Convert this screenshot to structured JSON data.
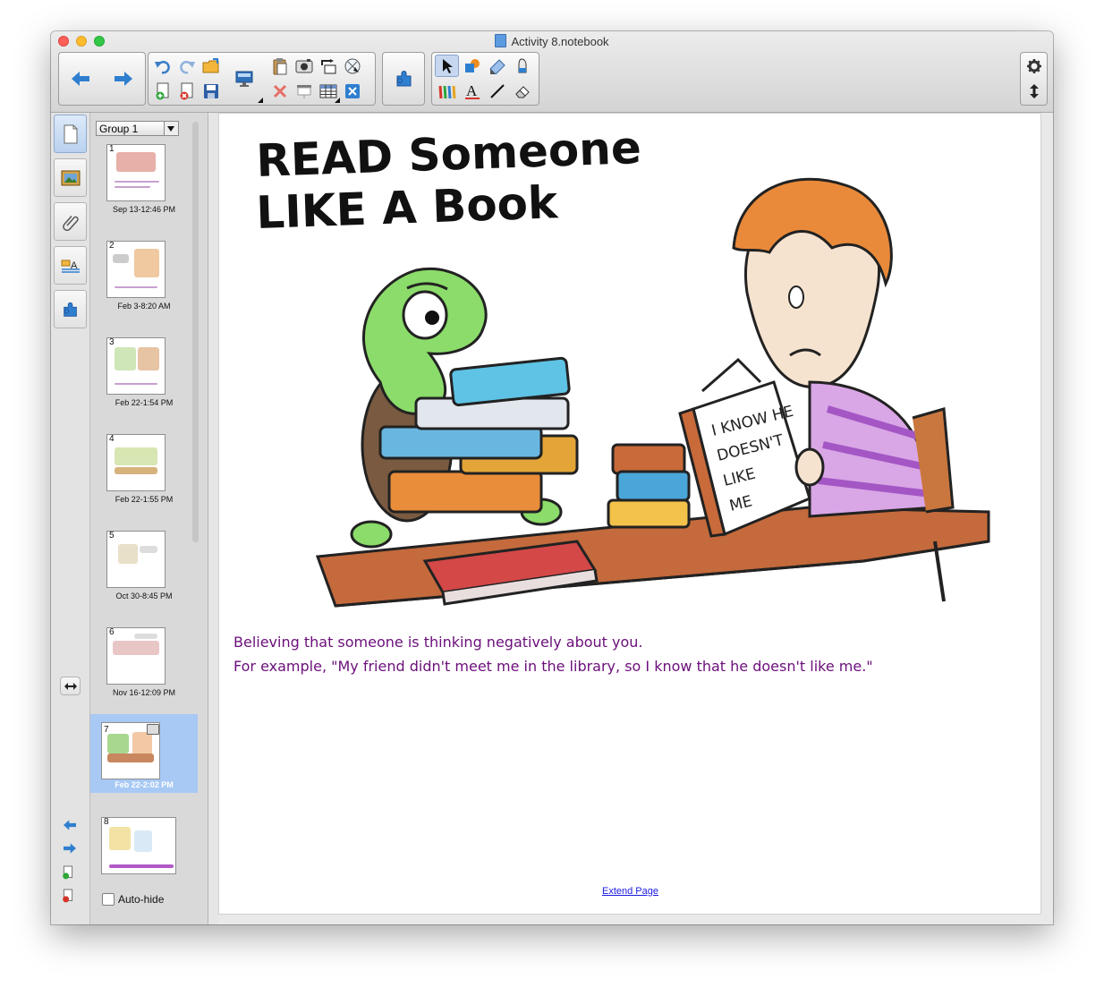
{
  "window": {
    "title": "Activity 8.notebook"
  },
  "sorter": {
    "group_label": "Group 1",
    "autohide_label": "Auto-hide",
    "pages": [
      {
        "num": "1",
        "date": "Sep 13-12:46 PM"
      },
      {
        "num": "2",
        "date": "Feb 3-8:20 AM"
      },
      {
        "num": "3",
        "date": "Feb 22-1:54 PM"
      },
      {
        "num": "4",
        "date": "Feb 22-1:55 PM"
      },
      {
        "num": "5",
        "date": "Oct 30-8:45 PM"
      },
      {
        "num": "6",
        "date": "Nov 16-12:09 PM"
      },
      {
        "num": "7",
        "date": "Feb 22-2:02 PM"
      },
      {
        "num": "8",
        "date": ""
      }
    ]
  },
  "canvas": {
    "cartoon_title_line1": "READ Someone",
    "cartoon_title_line2": "LIKE A Book",
    "book_text_1": "I KNOW HE",
    "book_text_2": "DOESN'T",
    "book_text_3": "LIKE",
    "book_text_4": "ME",
    "caption_line1": "Believing that someone is thinking negatively about you.",
    "caption_line2": "For example, \"My friend didn't meet me in the library, so I know that he doesn't like me.\"",
    "extend_link": "Extend Page"
  },
  "colors": {
    "caption": "#6b0f7a",
    "selection": "#a8c9f4",
    "accent_blue": "#2f7fd0"
  },
  "icons": [
    "back-icon",
    "forward-icon",
    "undo-icon",
    "redo-icon",
    "open-icon",
    "new-page-icon",
    "delete-page-icon",
    "save-icon",
    "screen-shade-icon",
    "paste-icon",
    "delete-icon",
    "screenshot-icon",
    "screen-capture-icon",
    "table-icon",
    "rotate-icon",
    "full-screen-icon",
    "fill-icon",
    "addon-icon",
    "select-icon",
    "shapes-icon",
    "magic-pen-icon",
    "pens-icon",
    "text-icon",
    "line-icon",
    "eraser-icon",
    "settings-icon",
    "toolbar-position-icon"
  ]
}
